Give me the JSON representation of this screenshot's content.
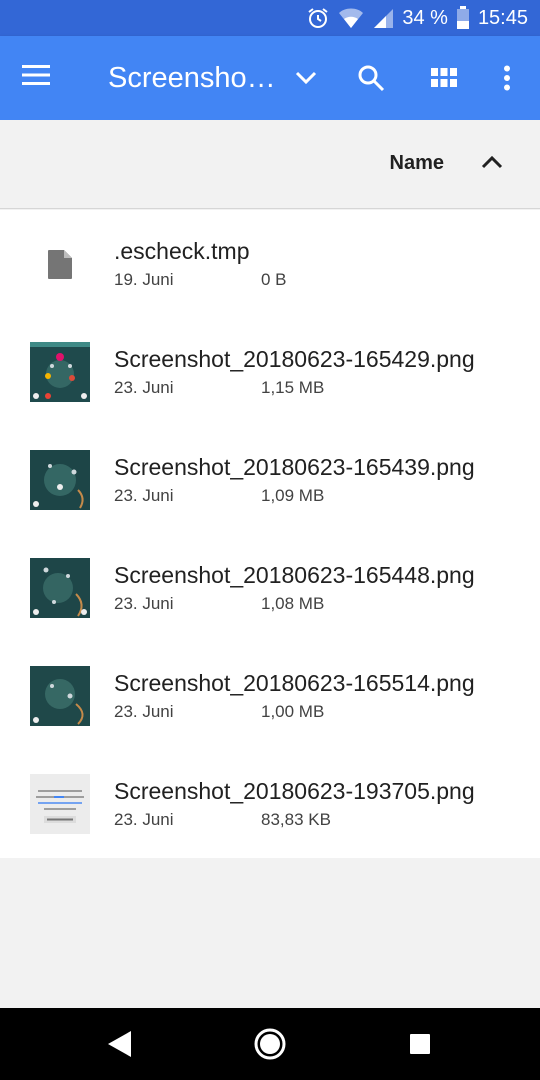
{
  "status_bar": {
    "battery": "34 %",
    "time": "15:45",
    "icons": [
      "alarm-icon",
      "wifi-icon",
      "signal-icon",
      "battery-icon"
    ]
  },
  "toolbar": {
    "title": "Screensho…",
    "icons": [
      "menu-icon",
      "chevron-down-icon",
      "search-icon",
      "grid-view-icon",
      "more-vert-icon"
    ],
    "color": "#4285f4",
    "status_color": "#3367d6"
  },
  "sort": {
    "label": "Name",
    "direction_icon": "arrow-up-icon"
  },
  "files": [
    {
      "name": ".escheck.tmp",
      "date": "19. Juni",
      "size": "0 B",
      "icon": "file-icon"
    },
    {
      "name": "Screenshot_20180623-165429.png",
      "date": "23. Juni",
      "size": "1,15 MB",
      "icon": "image-thumbnail"
    },
    {
      "name": "Screenshot_20180623-165439.png",
      "date": "23. Juni",
      "size": "1,09 MB",
      "icon": "image-thumbnail"
    },
    {
      "name": "Screenshot_20180623-165448.png",
      "date": "23. Juni",
      "size": "1,08 MB",
      "icon": "image-thumbnail"
    },
    {
      "name": "Screenshot_20180623-165514.png",
      "date": "23. Juni",
      "size": "1,00 MB",
      "icon": "image-thumbnail"
    },
    {
      "name": "Screenshot_20180623-193705.png",
      "date": "23. Juni",
      "size": "83,83 KB",
      "icon": "image-thumbnail"
    }
  ],
  "nav_bar": {
    "icons": [
      "back-icon",
      "home-icon",
      "recents-icon"
    ]
  }
}
